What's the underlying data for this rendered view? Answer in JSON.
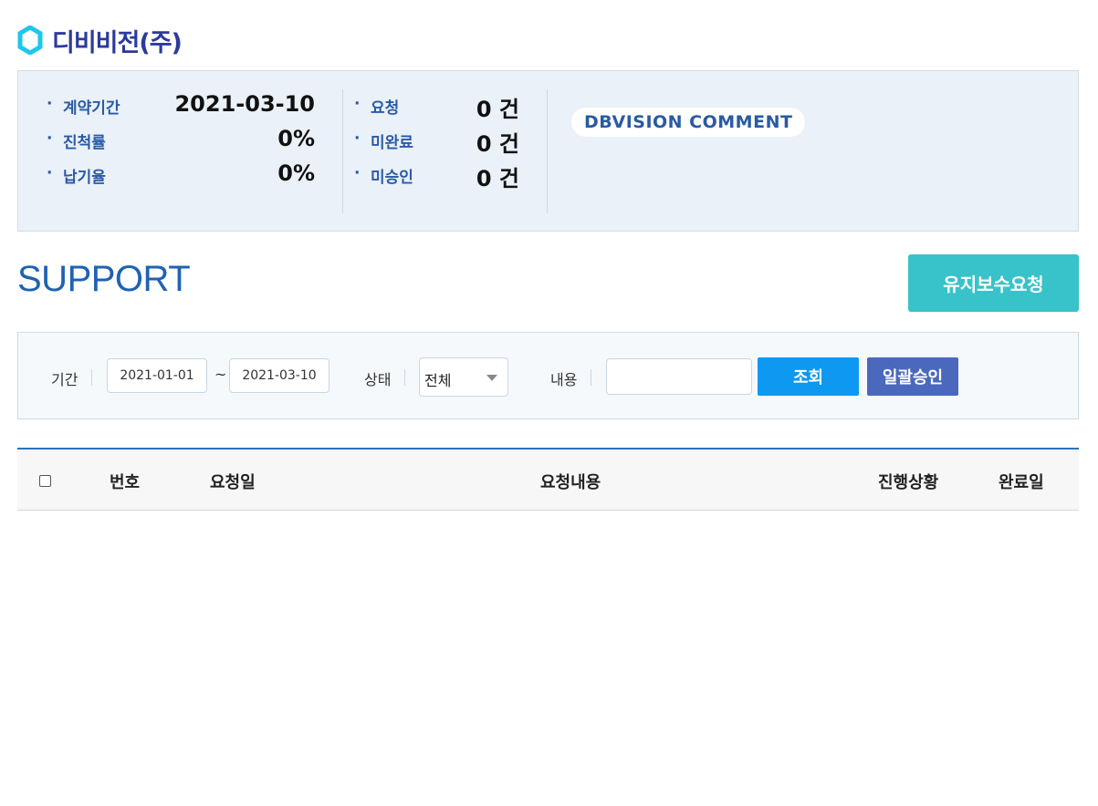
{
  "company": {
    "name": "디비비전(주)",
    "logo_icon": "hexagon-icon"
  },
  "summary": {
    "col1": [
      {
        "label": "계약기간",
        "value": "2021-03-10"
      },
      {
        "label": "진척률",
        "value": "0%"
      },
      {
        "label": "납기율",
        "value": "0%"
      }
    ],
    "col2": [
      {
        "label": "요청",
        "value": "0 건"
      },
      {
        "label": "미완료",
        "value": "0 건"
      },
      {
        "label": "미승인",
        "value": "0 건"
      }
    ],
    "comment_badge": "DBVISION COMMENT"
  },
  "support": {
    "title": "SUPPORT",
    "request_button": "유지보수요청"
  },
  "filter": {
    "period_label": "기간",
    "date_from": "2021-01-01",
    "tilde": "~",
    "date_to": "2021-03-10",
    "status_label": "상태",
    "status_value": "전체",
    "content_label": "내용",
    "content_value": "",
    "search_button": "조회",
    "approve_button": "일괄승인"
  },
  "table": {
    "headers": [
      "번호",
      "요청일",
      "요청내용",
      "진행상황",
      "완료일"
    ]
  },
  "colors": {
    "brand": "#2d3a9c",
    "accent_blue": "#1f62b3",
    "teal": "#37c3c9",
    "search_btn": "#0d98f2",
    "approve_btn": "#4a69bd"
  }
}
